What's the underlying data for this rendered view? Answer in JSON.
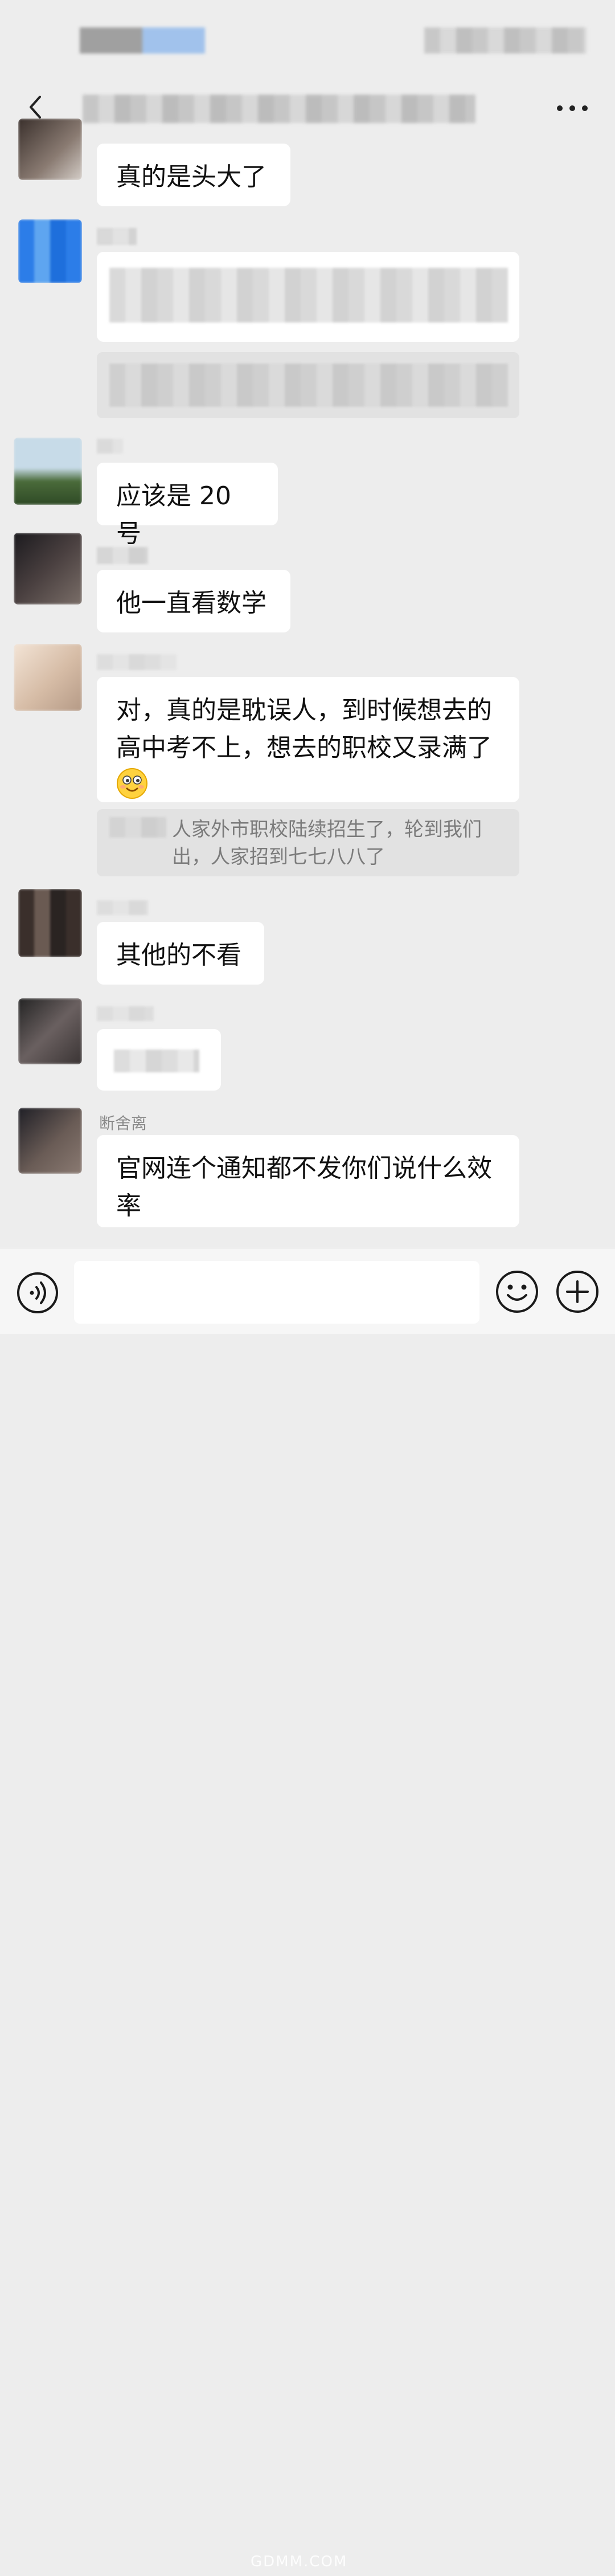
{
  "status_bar": {
    "time": "",
    "icons": ""
  },
  "header": {
    "title": "",
    "back_icon": "chevron-left-icon",
    "more_icon": "ellipsis-icon"
  },
  "messages": [
    {
      "sender": "",
      "text": "真的是头大了"
    },
    {
      "sender": "",
      "text": "",
      "quote": ""
    },
    {
      "sender": "",
      "text": "应该是 20 号"
    },
    {
      "sender": "",
      "text": "他一直看数学"
    },
    {
      "sender": "",
      "text": "对，真的是耽误人，到时候想去的高中考不上，想去的职校又录满了",
      "emoji": "smiling-face-icon",
      "quote": "人家外市职校陆续招生了，轮到我们出，人家招到七七八八了"
    },
    {
      "sender": "",
      "text": "其他的不看"
    },
    {
      "sender": "",
      "text": ""
    },
    {
      "sender": "断舍离",
      "text": "官网连个通知都不发你们说什么效率"
    }
  ],
  "input": {
    "placeholder": "",
    "value": ""
  },
  "bottom_bar": {
    "voice_icon": "voice-icon",
    "emoji_icon": "emoji-icon",
    "plus_icon": "plus-icon"
  },
  "watermark": "GDMM.COM",
  "colors": {
    "background": "#ededed",
    "bubble": "#ffffff",
    "quote": "#e2e2e2",
    "sender": "#8a8a8a"
  }
}
